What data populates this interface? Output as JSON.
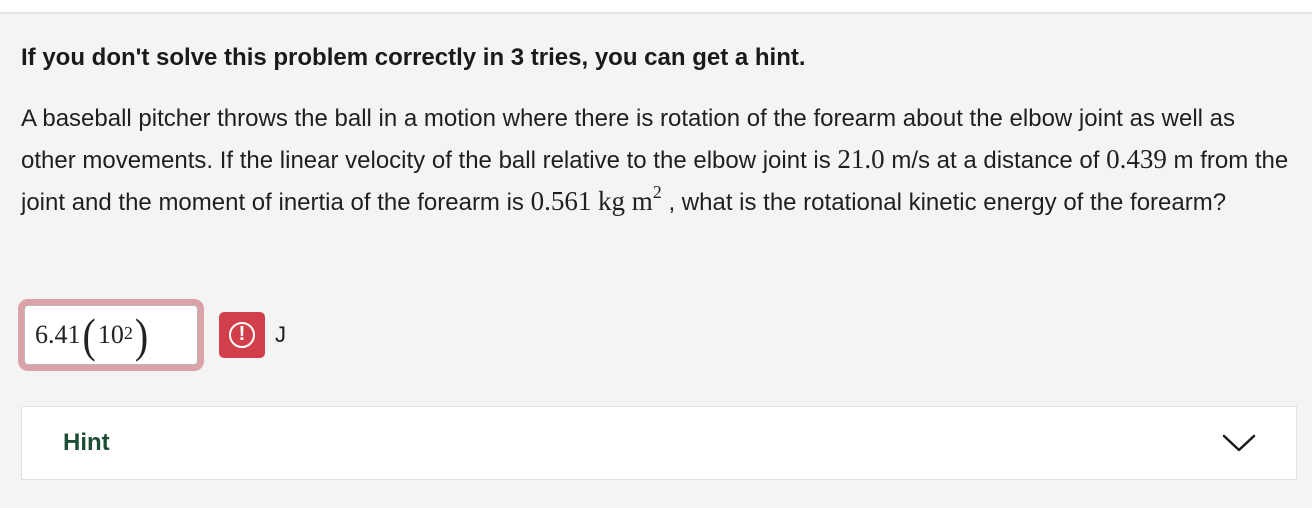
{
  "notice": "If you don't solve this problem correctly in 3 tries, you can get a hint.",
  "problem": {
    "part1": "A baseball pitcher throws the ball in a motion where there is rotation of the forearm about the elbow joint as well as other movements. If the linear velocity of the ball relative to the elbow joint is ",
    "velocity": "21.0",
    "part2": " m/s at a distance of ",
    "distance": "0.439",
    "part3": " m from the joint and the moment of inertia of the forearm is ",
    "inertia": "0.561",
    "inertia_unit": "kg m",
    "inertia_exp": "2",
    "part4": " , what is the rotational kinetic energy of the forearm?"
  },
  "answer": {
    "mantissa": "6.41",
    "base": "10",
    "exponent": "2",
    "status_icon": "error-icon",
    "unit": "J"
  },
  "hint": {
    "label": "Hint",
    "icon": "chevron-down-icon"
  },
  "colors": {
    "error": "#d13f4a",
    "error_glow": "#dba3a8",
    "hint_text": "#1e4d35"
  }
}
